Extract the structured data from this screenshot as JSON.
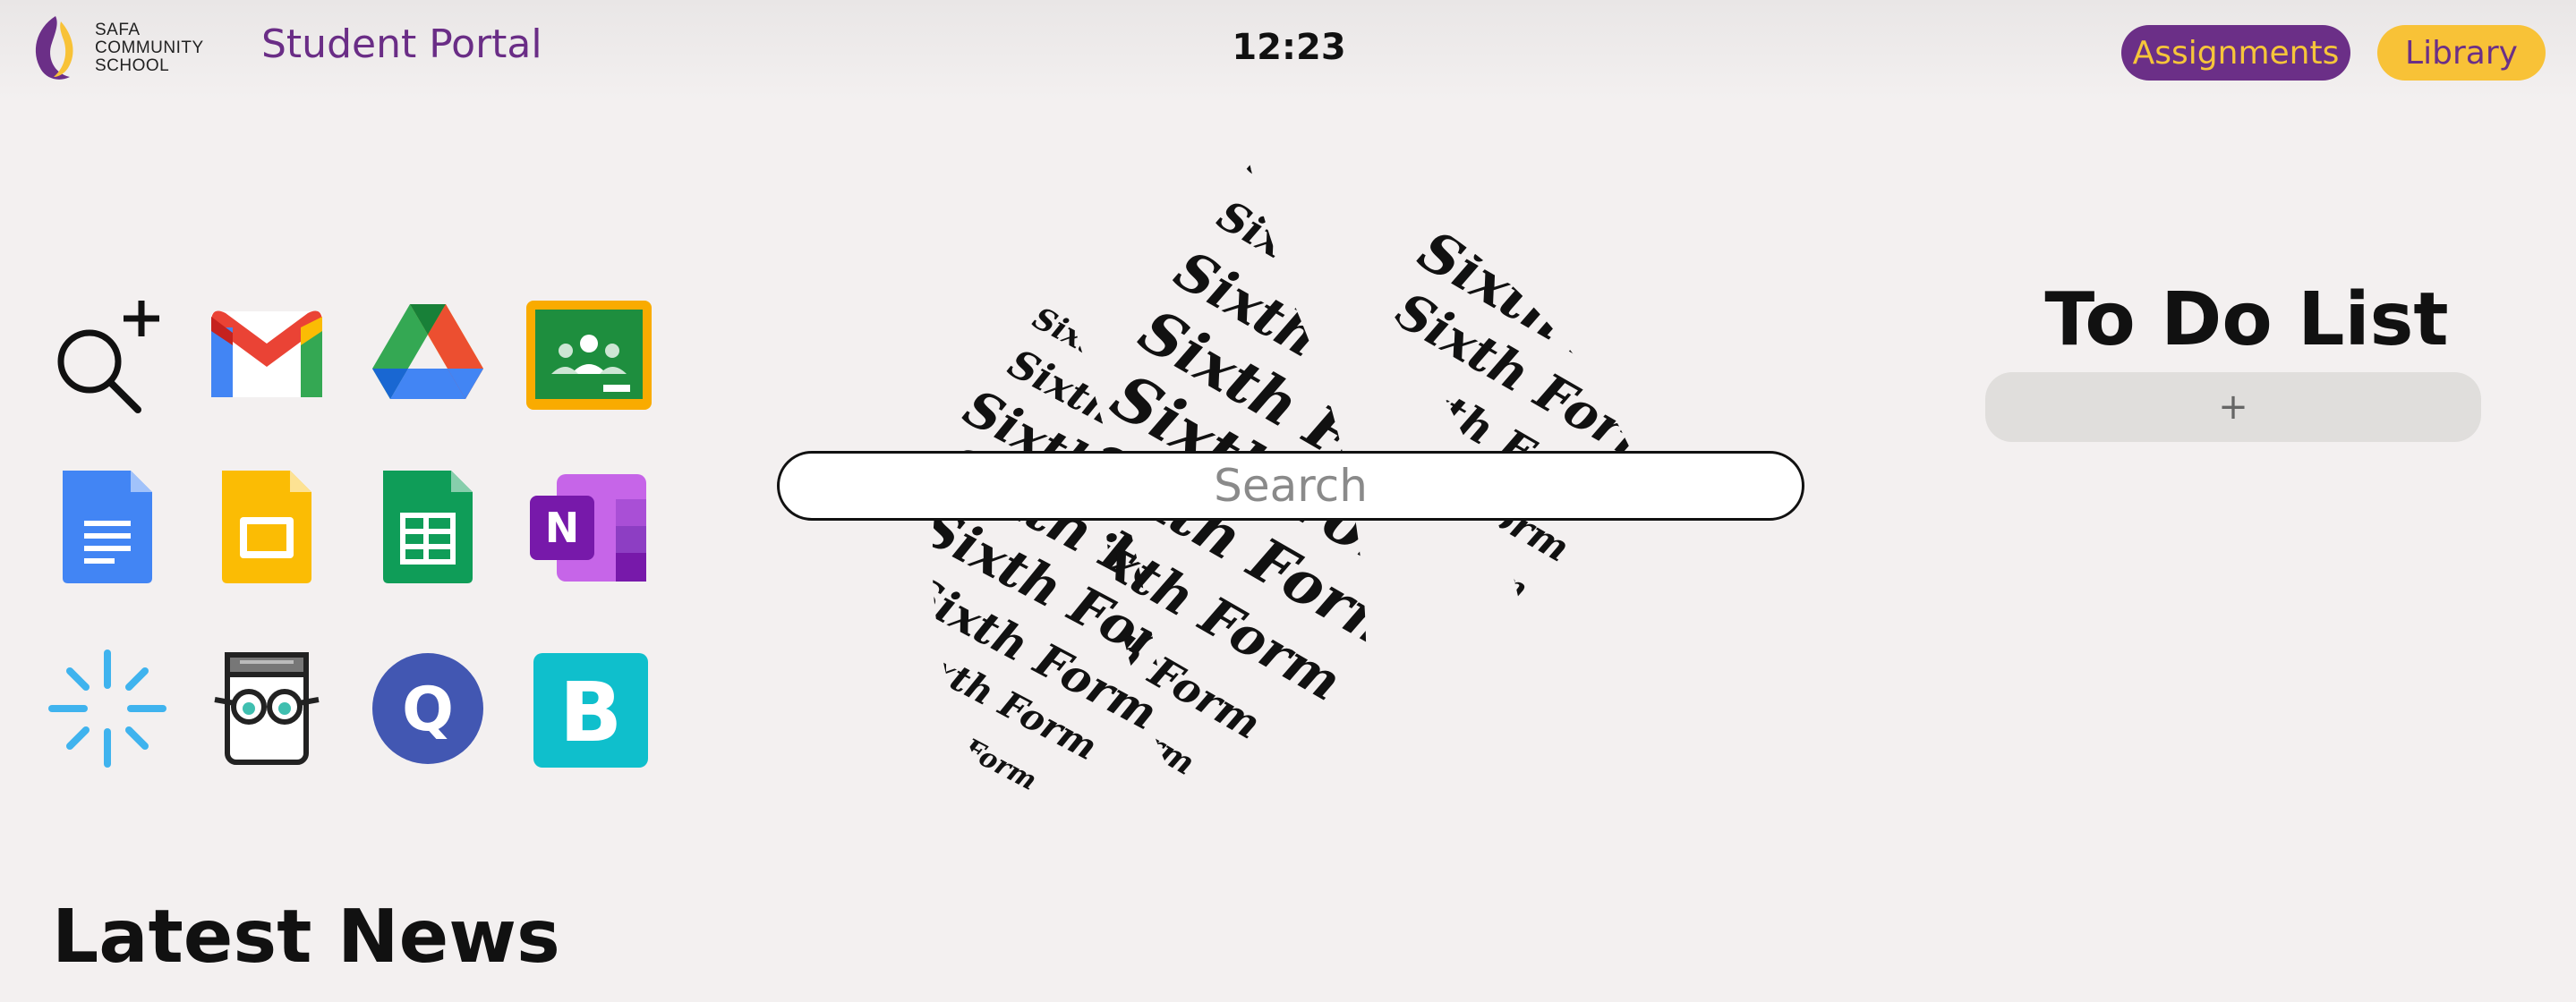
{
  "header": {
    "school_name": [
      "SAFA",
      "COMMUNITY",
      "SCHOOL"
    ],
    "portal_title": "Student Portal",
    "clock": "12:23",
    "assignments_label": "Assignments",
    "library_label": "Library"
  },
  "background_text": "Sixth Form",
  "search": {
    "placeholder": "Search"
  },
  "apps": [
    {
      "name": "search-plus-icon"
    },
    {
      "name": "gmail-icon"
    },
    {
      "name": "google-drive-icon"
    },
    {
      "name": "google-classroom-icon"
    },
    {
      "name": "google-docs-icon"
    },
    {
      "name": "google-slides-icon"
    },
    {
      "name": "google-sheets-icon"
    },
    {
      "name": "onenote-icon",
      "letter": "N"
    },
    {
      "name": "sparkle-icon"
    },
    {
      "name": "reading-book-icon"
    },
    {
      "name": "quizlet-icon",
      "letter": "Q"
    },
    {
      "name": "bedrock-icon",
      "letter": "B"
    }
  ],
  "todo": {
    "title": "To Do List",
    "add_label": "+"
  },
  "news": {
    "title": "Latest News"
  },
  "colors": {
    "purple": "#6b2f87",
    "yellow": "#f8c237",
    "background": "#f3f0f0"
  }
}
